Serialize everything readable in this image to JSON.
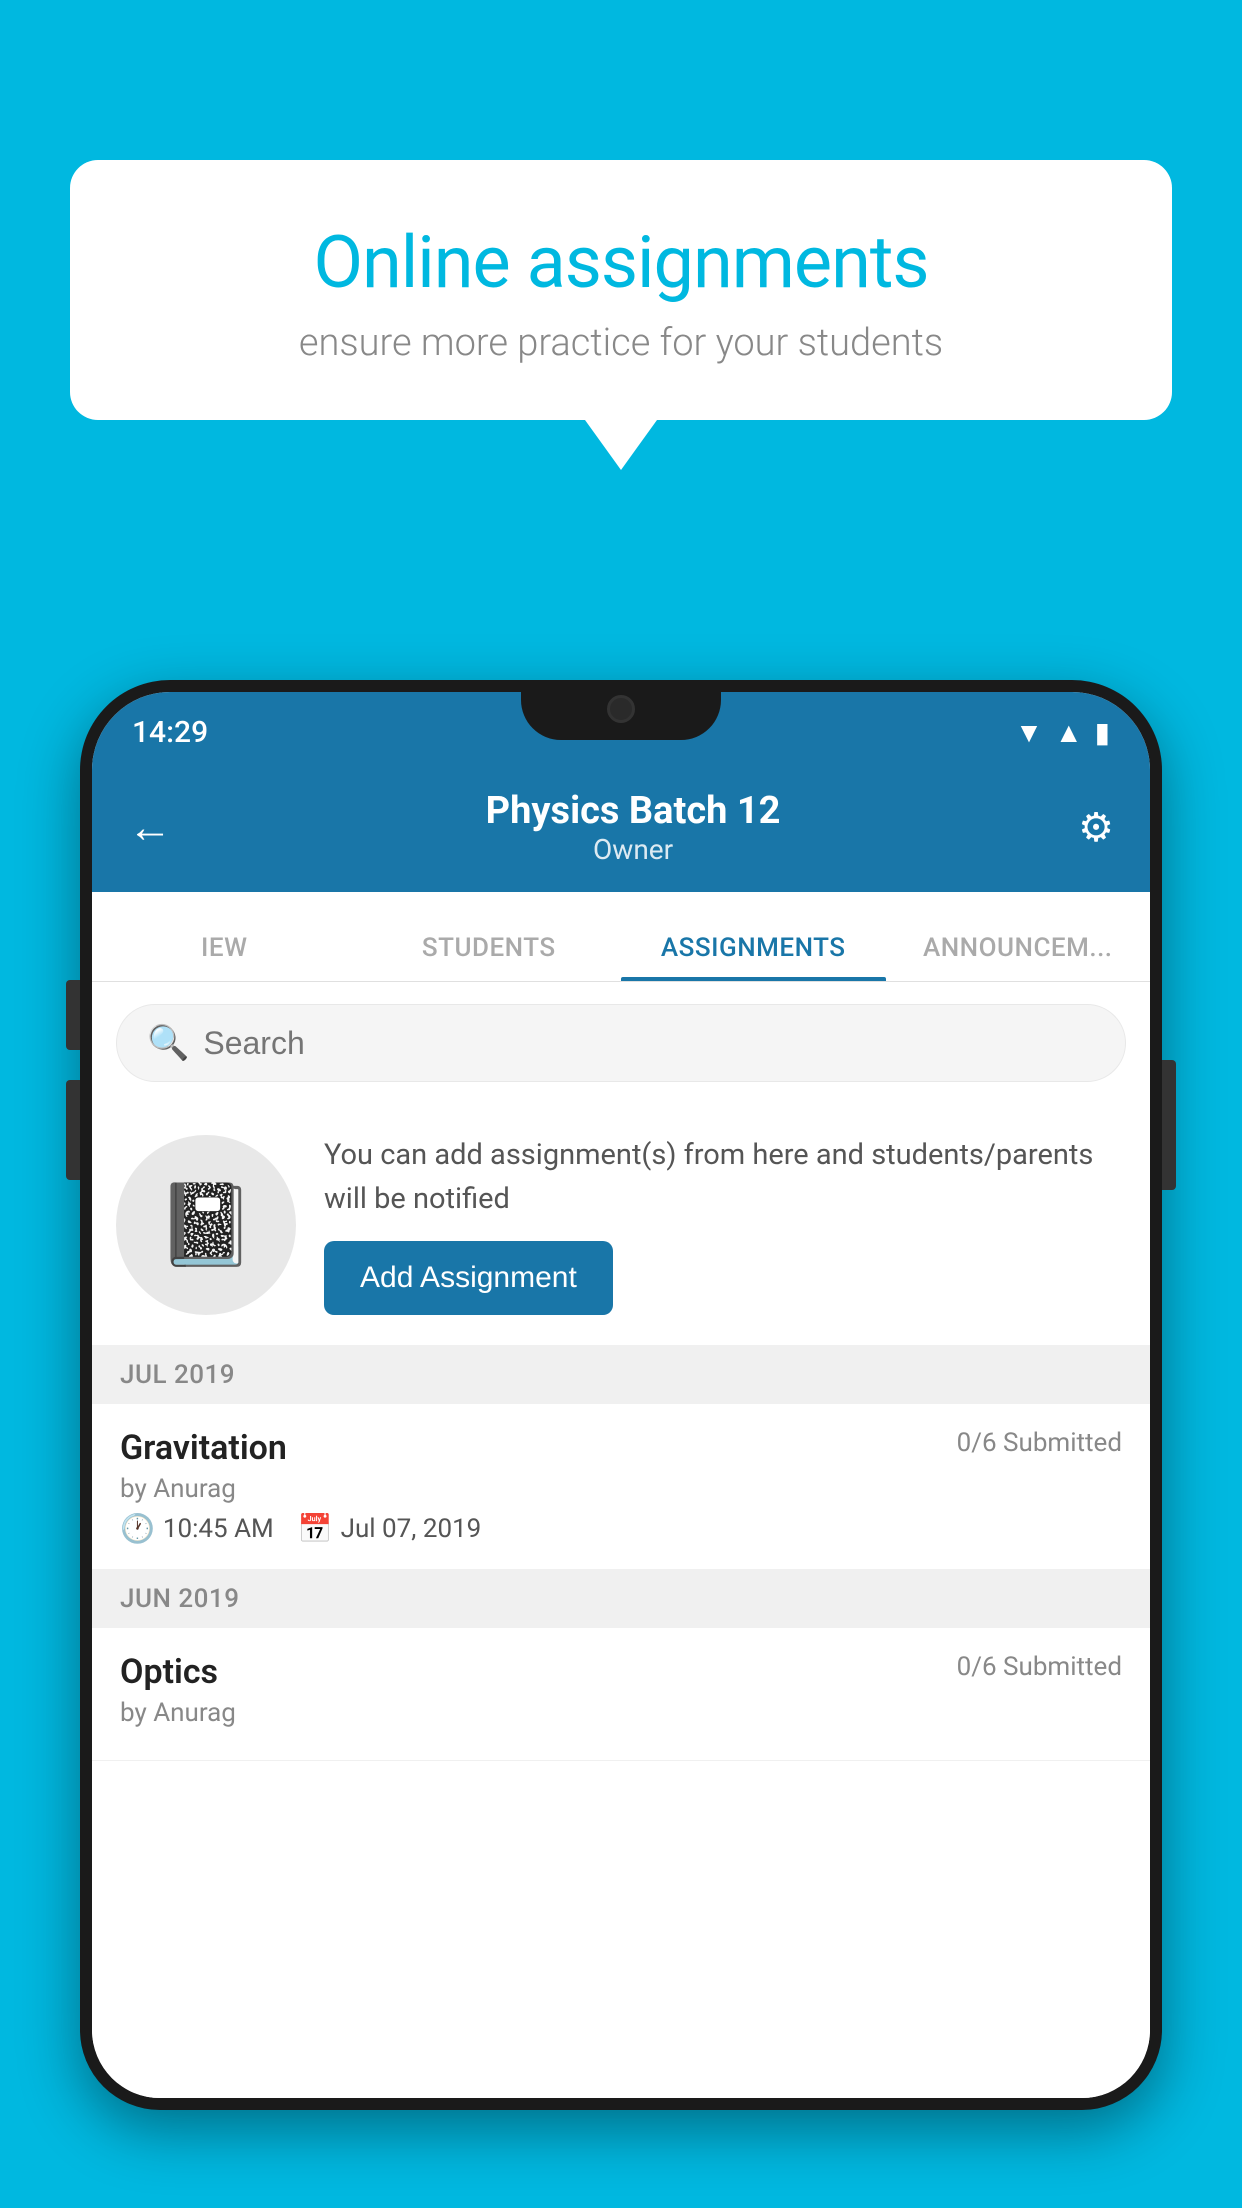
{
  "background_color": "#00B8E0",
  "speech_bubble": {
    "title": "Online assignments",
    "subtitle": "ensure more practice for your students"
  },
  "phone": {
    "status_bar": {
      "time": "14:29",
      "icons": [
        "wifi",
        "signal",
        "battery"
      ]
    },
    "top_bar": {
      "title": "Physics Batch 12",
      "subtitle": "Owner",
      "back_label": "←",
      "settings_label": "⚙"
    },
    "tabs": [
      {
        "label": "IEW",
        "active": false
      },
      {
        "label": "STUDENTS",
        "active": false
      },
      {
        "label": "ASSIGNMENTS",
        "active": true
      },
      {
        "label": "ANNOUNCEM...",
        "active": false
      }
    ],
    "search": {
      "placeholder": "Search"
    },
    "promo": {
      "description": "You can add assignment(s) from here and students/parents will be notified",
      "button_label": "Add Assignment"
    },
    "sections": [
      {
        "header": "JUL 2019",
        "assignments": [
          {
            "name": "Gravitation",
            "submitted": "0/6 Submitted",
            "by": "by Anurag",
            "time": "10:45 AM",
            "date": "Jul 07, 2019"
          }
        ]
      },
      {
        "header": "JUN 2019",
        "assignments": [
          {
            "name": "Optics",
            "submitted": "0/6 Submitted",
            "by": "by Anurag",
            "time": "",
            "date": ""
          }
        ]
      }
    ]
  }
}
